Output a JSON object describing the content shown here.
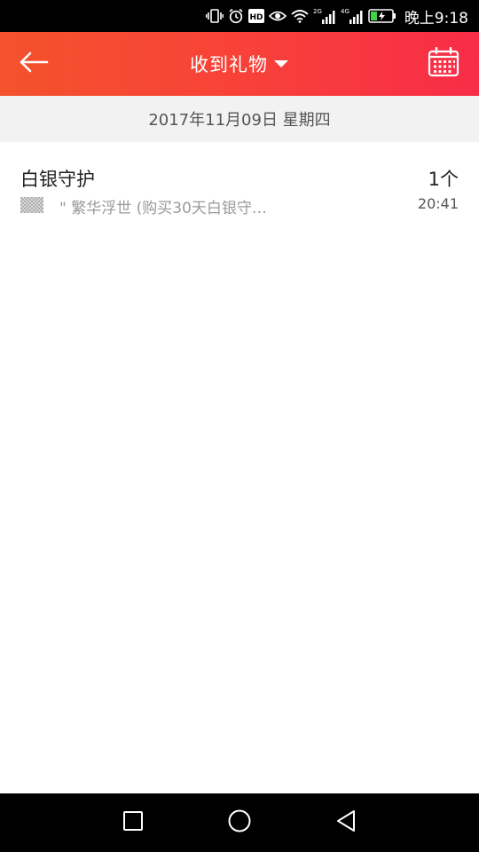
{
  "status_bar": {
    "time": "晚上9:18",
    "signal_1_label": "2G",
    "signal_2_label": "4G",
    "hd_label": "HD",
    "icons": [
      "vibrate-icon",
      "alarm-icon",
      "hd-icon",
      "eye-icon",
      "wifi-icon",
      "signal-2g-icon",
      "signal-4g-icon",
      "battery-charging-icon"
    ]
  },
  "app_bar": {
    "title": "收到礼物",
    "back_icon": "back-arrow-icon",
    "dropdown_icon": "caret-down-icon",
    "calendar_icon": "calendar-icon",
    "colors": {
      "gradient_start": "#f4522c",
      "gradient_end": "#f82c48"
    }
  },
  "date_header": {
    "text": "2017年11月09日 星期四"
  },
  "gifts": [
    {
      "name": "白银守护",
      "count": "1个",
      "message": "\" 繁华浮世 (购买30天白银守…",
      "time": "20:41"
    }
  ],
  "nav_bar": {
    "icons": [
      "recents-square-icon",
      "home-circle-icon",
      "back-triangle-icon"
    ]
  }
}
